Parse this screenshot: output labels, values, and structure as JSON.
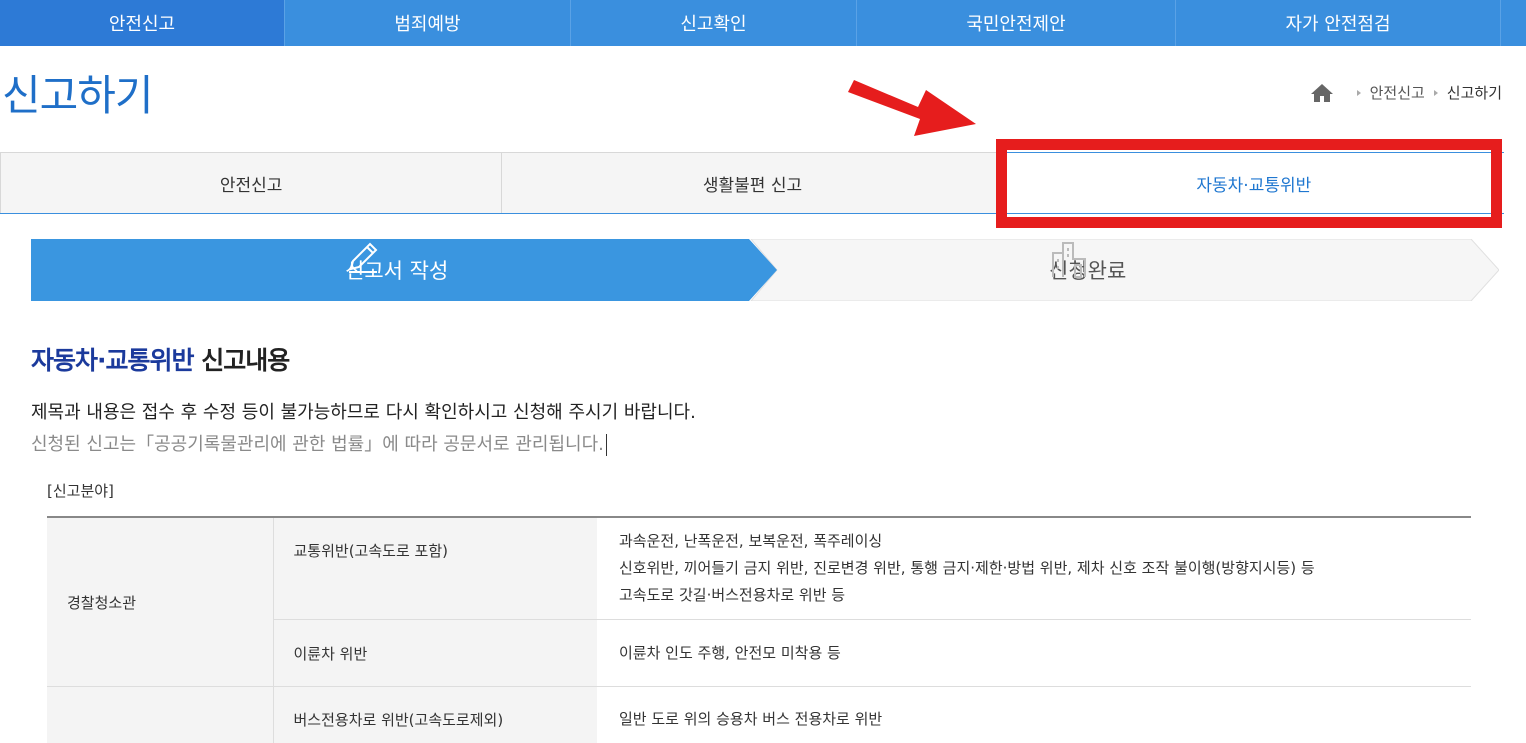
{
  "nav": {
    "items": [
      {
        "label": "안전신고",
        "active": true
      },
      {
        "label": "범죄예방",
        "active": false
      },
      {
        "label": "신고확인",
        "active": false
      },
      {
        "label": "국민안전제안",
        "active": false
      },
      {
        "label": "자가 안전점검",
        "active": false
      }
    ]
  },
  "page": {
    "title": "신고하기"
  },
  "breadcrumb": {
    "icon": "home-icon",
    "items": [
      "안전신고",
      "신고하기"
    ]
  },
  "subtabs": [
    {
      "label": "안전신고",
      "active": false
    },
    {
      "label": "생활불편 신고",
      "active": false
    },
    {
      "label": "자동차·교통위반",
      "active": true
    }
  ],
  "steps": [
    {
      "label": "신고서 작성",
      "icon": "pencil-icon",
      "active": true
    },
    {
      "label": "신청완료",
      "icon": "building-icon",
      "active": false
    }
  ],
  "section": {
    "title_highlight": "자동차·교통위반",
    "title_rest": " 신고내용",
    "notice_line1": "제목과 내용은 접수 후 수정 등이 불가능하므로 다시 확인하시고 신청해 주시기 바랍니다.",
    "notice_line2": "신청된 신고는「공공기록물관리에 관한 법률」에 따라 공문서로 관리됩니다."
  },
  "field": {
    "label": "[신고분야]"
  },
  "table": {
    "org_1": "경찰청소관",
    "rows": [
      {
        "category": "교통위반(고속도로 포함)",
        "lines": [
          "과속운전, 난폭운전, 보복운전, 폭주레이싱",
          "신호위반, 끼어들기 금지 위반, 진로변경 위반, 통행 금지·제한·방법 위반, 제차 신호 조작 불이행(방향지시등) 등",
          "고속도로 갓길·버스전용차로 위반 등"
        ]
      },
      {
        "category": "이륜차 위반",
        "lines": [
          "이륜차 인도 주행, 안전모 미착용 등"
        ]
      },
      {
        "category": "버스전용차로 위반(고속도로제외)",
        "lines": [
          "일반 도로 위의 승용차 버스 전용차로 위반"
        ]
      }
    ]
  },
  "colors": {
    "nav_bg": "#3a8fde",
    "accent": "#1f77d0",
    "annotation": "#e61d1d"
  }
}
